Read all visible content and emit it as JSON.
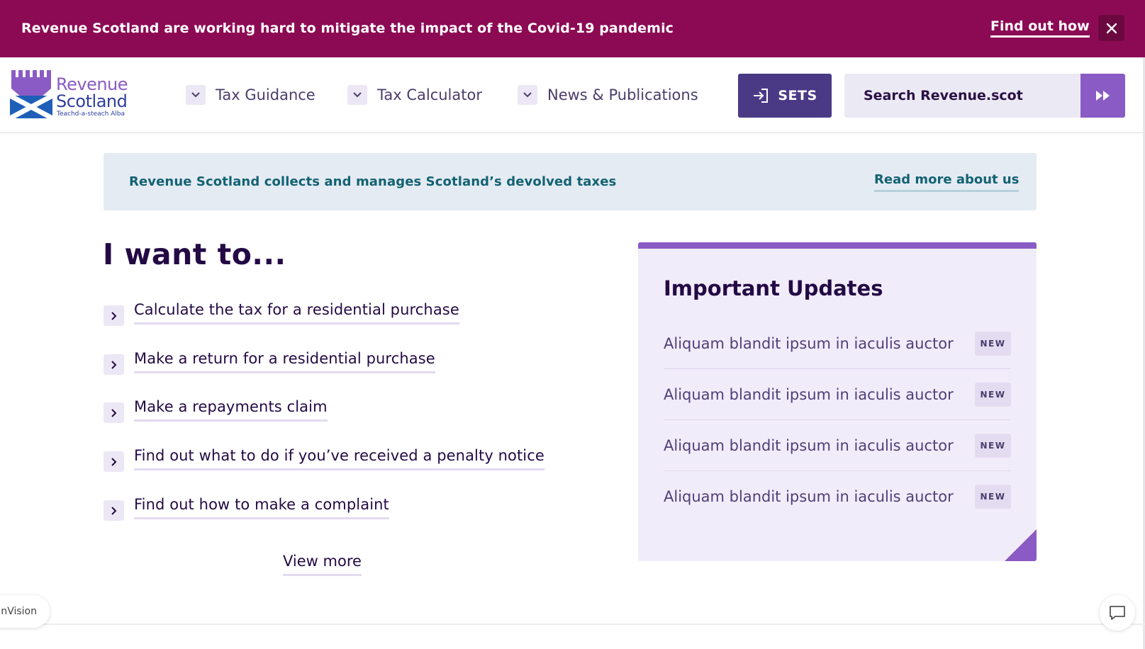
{
  "banner": {
    "message": "Revenue Scotland are working hard to mitigate the impact of the Covid-19 pandemic",
    "link_label": "Find out how",
    "close_icon": "close-icon"
  },
  "header": {
    "logo": {
      "line1": "Revenue",
      "line2": "Scotland",
      "tagline": "Teachd-a-steach Alba"
    },
    "nav": [
      {
        "label": "Tax Guidance",
        "icon": "chevron-down-icon"
      },
      {
        "label": "Tax Calculator",
        "icon": "chevron-down-icon"
      },
      {
        "label": "News & Publications",
        "icon": "chevron-down-icon"
      }
    ],
    "sets_label": "SETS",
    "sets_icon": "sign-in-icon",
    "search_placeholder": "Search Revenue.scot",
    "search_icon": "fast-forward-icon"
  },
  "info": {
    "text": "Revenue Scotland collects and manages Scotland’s devolved taxes",
    "link_label": "Read more about us"
  },
  "tasks": {
    "heading": "I want to...",
    "items": [
      {
        "label": "Calculate the tax for a residential purchase"
      },
      {
        "label": "Make a return for a residential purchase"
      },
      {
        "label": "Make a repayments claim"
      },
      {
        "label": "Find out what to do if you’ve received a penalty notice"
      },
      {
        "label": "Find out how to make a complaint"
      }
    ],
    "view_more": "View more"
  },
  "updates": {
    "title": "Important Updates",
    "items": [
      {
        "text": "Aliquam blandit ipsum in iaculis auctor",
        "badge": "NEW"
      },
      {
        "text": "Aliquam blandit ipsum in iaculis auctor",
        "badge": "NEW"
      },
      {
        "text": "Aliquam blandit ipsum in iaculis auctor",
        "badge": "NEW"
      },
      {
        "text": "Aliquam blandit ipsum in iaculis auctor",
        "badge": "NEW"
      }
    ]
  },
  "footer": {
    "invision_label": "nVision",
    "chat_icon": "chat-icon"
  },
  "colors": {
    "banner": "#8c0a54",
    "brand_purple": "#8a5bc4",
    "sets_button": "#4a3a86",
    "heading": "#230a45",
    "info_text": "#136272"
  }
}
